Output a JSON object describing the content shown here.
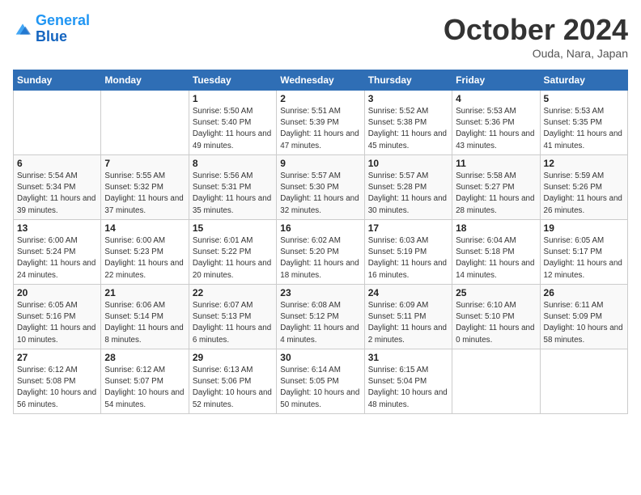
{
  "logo": {
    "line1": "General",
    "line2": "Blue"
  },
  "title": "October 2024",
  "subtitle": "Ouda, Nara, Japan",
  "weekdays": [
    "Sunday",
    "Monday",
    "Tuesday",
    "Wednesday",
    "Thursday",
    "Friday",
    "Saturday"
  ],
  "weeks": [
    [
      {
        "day": "",
        "detail": ""
      },
      {
        "day": "",
        "detail": ""
      },
      {
        "day": "1",
        "detail": "Sunrise: 5:50 AM\nSunset: 5:40 PM\nDaylight: 11 hours and 49 minutes."
      },
      {
        "day": "2",
        "detail": "Sunrise: 5:51 AM\nSunset: 5:39 PM\nDaylight: 11 hours and 47 minutes."
      },
      {
        "day": "3",
        "detail": "Sunrise: 5:52 AM\nSunset: 5:38 PM\nDaylight: 11 hours and 45 minutes."
      },
      {
        "day": "4",
        "detail": "Sunrise: 5:53 AM\nSunset: 5:36 PM\nDaylight: 11 hours and 43 minutes."
      },
      {
        "day": "5",
        "detail": "Sunrise: 5:53 AM\nSunset: 5:35 PM\nDaylight: 11 hours and 41 minutes."
      }
    ],
    [
      {
        "day": "6",
        "detail": "Sunrise: 5:54 AM\nSunset: 5:34 PM\nDaylight: 11 hours and 39 minutes."
      },
      {
        "day": "7",
        "detail": "Sunrise: 5:55 AM\nSunset: 5:32 PM\nDaylight: 11 hours and 37 minutes."
      },
      {
        "day": "8",
        "detail": "Sunrise: 5:56 AM\nSunset: 5:31 PM\nDaylight: 11 hours and 35 minutes."
      },
      {
        "day": "9",
        "detail": "Sunrise: 5:57 AM\nSunset: 5:30 PM\nDaylight: 11 hours and 32 minutes."
      },
      {
        "day": "10",
        "detail": "Sunrise: 5:57 AM\nSunset: 5:28 PM\nDaylight: 11 hours and 30 minutes."
      },
      {
        "day": "11",
        "detail": "Sunrise: 5:58 AM\nSunset: 5:27 PM\nDaylight: 11 hours and 28 minutes."
      },
      {
        "day": "12",
        "detail": "Sunrise: 5:59 AM\nSunset: 5:26 PM\nDaylight: 11 hours and 26 minutes."
      }
    ],
    [
      {
        "day": "13",
        "detail": "Sunrise: 6:00 AM\nSunset: 5:24 PM\nDaylight: 11 hours and 24 minutes."
      },
      {
        "day": "14",
        "detail": "Sunrise: 6:00 AM\nSunset: 5:23 PM\nDaylight: 11 hours and 22 minutes."
      },
      {
        "day": "15",
        "detail": "Sunrise: 6:01 AM\nSunset: 5:22 PM\nDaylight: 11 hours and 20 minutes."
      },
      {
        "day": "16",
        "detail": "Sunrise: 6:02 AM\nSunset: 5:20 PM\nDaylight: 11 hours and 18 minutes."
      },
      {
        "day": "17",
        "detail": "Sunrise: 6:03 AM\nSunset: 5:19 PM\nDaylight: 11 hours and 16 minutes."
      },
      {
        "day": "18",
        "detail": "Sunrise: 6:04 AM\nSunset: 5:18 PM\nDaylight: 11 hours and 14 minutes."
      },
      {
        "day": "19",
        "detail": "Sunrise: 6:05 AM\nSunset: 5:17 PM\nDaylight: 11 hours and 12 minutes."
      }
    ],
    [
      {
        "day": "20",
        "detail": "Sunrise: 6:05 AM\nSunset: 5:16 PM\nDaylight: 11 hours and 10 minutes."
      },
      {
        "day": "21",
        "detail": "Sunrise: 6:06 AM\nSunset: 5:14 PM\nDaylight: 11 hours and 8 minutes."
      },
      {
        "day": "22",
        "detail": "Sunrise: 6:07 AM\nSunset: 5:13 PM\nDaylight: 11 hours and 6 minutes."
      },
      {
        "day": "23",
        "detail": "Sunrise: 6:08 AM\nSunset: 5:12 PM\nDaylight: 11 hours and 4 minutes."
      },
      {
        "day": "24",
        "detail": "Sunrise: 6:09 AM\nSunset: 5:11 PM\nDaylight: 11 hours and 2 minutes."
      },
      {
        "day": "25",
        "detail": "Sunrise: 6:10 AM\nSunset: 5:10 PM\nDaylight: 11 hours and 0 minutes."
      },
      {
        "day": "26",
        "detail": "Sunrise: 6:11 AM\nSunset: 5:09 PM\nDaylight: 10 hours and 58 minutes."
      }
    ],
    [
      {
        "day": "27",
        "detail": "Sunrise: 6:12 AM\nSunset: 5:08 PM\nDaylight: 10 hours and 56 minutes."
      },
      {
        "day": "28",
        "detail": "Sunrise: 6:12 AM\nSunset: 5:07 PM\nDaylight: 10 hours and 54 minutes."
      },
      {
        "day": "29",
        "detail": "Sunrise: 6:13 AM\nSunset: 5:06 PM\nDaylight: 10 hours and 52 minutes."
      },
      {
        "day": "30",
        "detail": "Sunrise: 6:14 AM\nSunset: 5:05 PM\nDaylight: 10 hours and 50 minutes."
      },
      {
        "day": "31",
        "detail": "Sunrise: 6:15 AM\nSunset: 5:04 PM\nDaylight: 10 hours and 48 minutes."
      },
      {
        "day": "",
        "detail": ""
      },
      {
        "day": "",
        "detail": ""
      }
    ]
  ]
}
